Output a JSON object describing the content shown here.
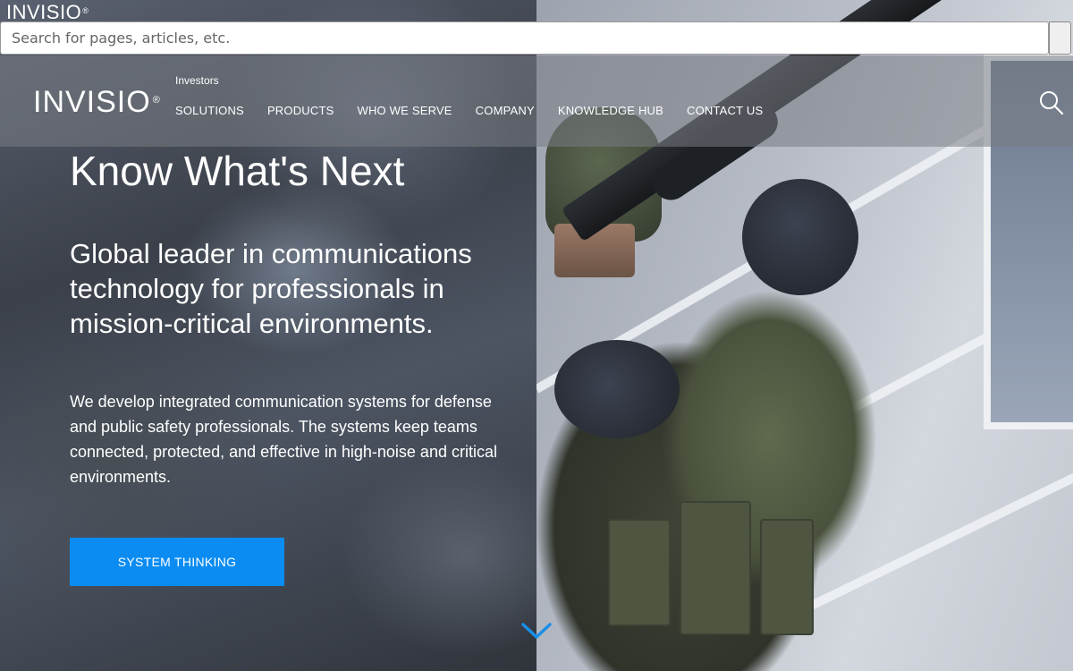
{
  "top_strip": {
    "mini_logo": "INVISIO",
    "registered_mark": "®",
    "search_placeholder": "Search for pages, articles, etc."
  },
  "header": {
    "logo": "INVISIO",
    "registered_mark": "®",
    "secondary_link": "Investors",
    "nav_items": [
      {
        "label": "SOLUTIONS"
      },
      {
        "label": "PRODUCTS"
      },
      {
        "label": "WHO WE SERVE"
      },
      {
        "label": "COMPANY"
      },
      {
        "label": "KNOWLEDGE HUB"
      },
      {
        "label": "CONTACT US"
      }
    ],
    "search_icon": "search-icon"
  },
  "hero": {
    "title": "Know What's Next",
    "subtitle": "Global leader in communications technology for professionals in mission-critical environments.",
    "body": "We develop integrated communication systems for defense and public safety professionals. The systems keep teams connected, protected, and effective in high-noise and critical environments.",
    "cta_label": "SYSTEM THINKING",
    "scroll_icon": "chevron-down-icon"
  },
  "colors": {
    "accent": "#0a8cf2",
    "scroll_chevron": "#1a8fe8",
    "header_overlay": "rgba(120,124,132,0.55)",
    "text": "#ffffff"
  }
}
